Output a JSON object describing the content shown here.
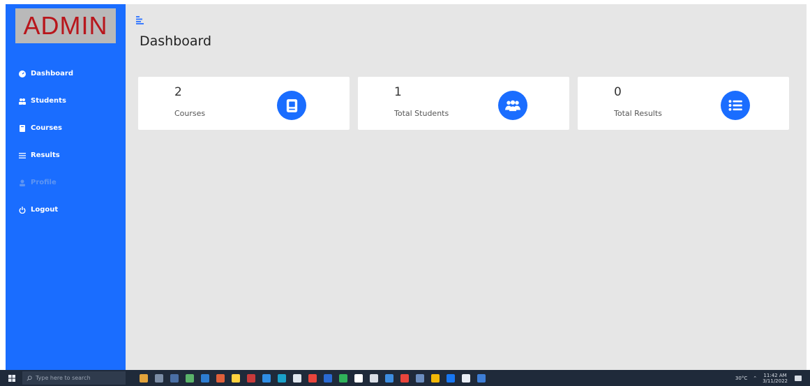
{
  "sidebar": {
    "brand": "ADMIN",
    "items": [
      {
        "label": "Dashboard",
        "icon": "dashboard-icon"
      },
      {
        "label": "Students",
        "icon": "users-icon"
      },
      {
        "label": "Courses",
        "icon": "book-icon"
      },
      {
        "label": "Results",
        "icon": "list-icon"
      },
      {
        "label": "Profile",
        "icon": "user-icon"
      },
      {
        "label": "Logout",
        "icon": "power-icon"
      }
    ]
  },
  "header": {
    "title": "Dashboard",
    "toggle_icon": "menu-toggle-icon"
  },
  "cards": [
    {
      "value": "2",
      "label": "Courses",
      "icon": "book-icon"
    },
    {
      "value": "1",
      "label": "Total Students",
      "icon": "users-icon"
    },
    {
      "value": "0",
      "label": "Total Results",
      "icon": "list-icon"
    }
  ],
  "taskbar": {
    "search_placeholder": "Type here to search",
    "weather": "30°C",
    "time": "11:42 AM",
    "date": "3/11/2022"
  },
  "colors": {
    "accent": "#1a6dff",
    "brand_text": "#b8161c",
    "background": "#e6e6e6",
    "taskbar": "#1f2a3a"
  }
}
